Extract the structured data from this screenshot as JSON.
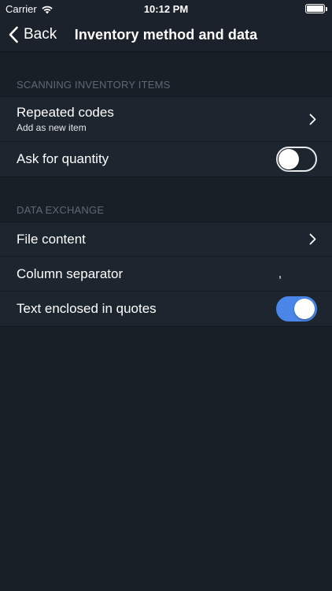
{
  "status_bar": {
    "carrier": "Carrier",
    "time": "10:12 PM"
  },
  "nav": {
    "back_label": "Back",
    "title": "Inventory method and data"
  },
  "sections": [
    {
      "header": "SCANNING INVENTORY ITEMS",
      "rows": [
        {
          "label": "Repeated codes",
          "sublabel": "Add as new item",
          "accessory": "chevron"
        },
        {
          "label": "Ask for quantity",
          "accessory": "toggle",
          "toggle_on": false
        }
      ]
    },
    {
      "header": "DATA EXCHANGE",
      "rows": [
        {
          "label": "File content",
          "accessory": "chevron"
        },
        {
          "label": "Column separator",
          "value": ","
        },
        {
          "label": "Text enclosed in quotes",
          "accessory": "toggle",
          "toggle_on": true
        }
      ]
    }
  ],
  "colors": {
    "background": "#181f27",
    "row_background": "#1d252e",
    "toggle_on": "#4a86e8",
    "section_header": "#5f6872"
  },
  "icons": {
    "back": "chevron-left-icon",
    "disclosure": "chevron-right-icon",
    "wifi": "wifi-icon",
    "battery": "battery-icon"
  }
}
